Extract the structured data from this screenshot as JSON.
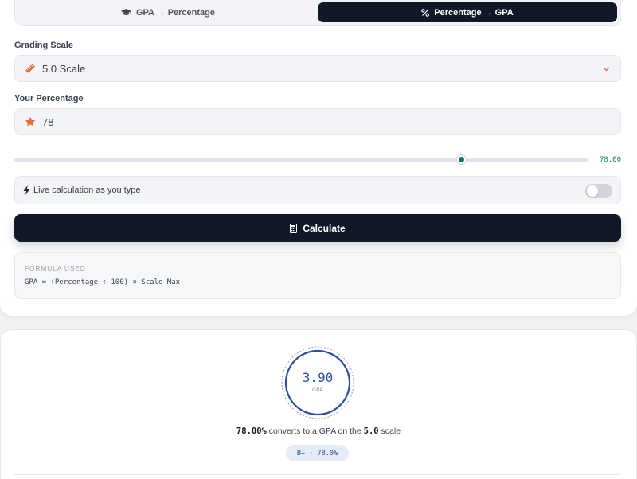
{
  "tabs": [
    {
      "label": "GPA → Percentage",
      "icon": "graduation-cap-icon",
      "active": false
    },
    {
      "label": "Percentage → GPA",
      "icon": "percent-icon",
      "active": true
    }
  ],
  "grading_scale": {
    "label": "Grading Scale",
    "value": "5.0 Scale",
    "icon": "ruler-icon"
  },
  "percentage": {
    "label": "Your Percentage",
    "value": "78",
    "icon": "star-icon"
  },
  "slider": {
    "value": 78,
    "min": 0,
    "max": 100,
    "readout": "78.00"
  },
  "live": {
    "label": "Live calculation as you type",
    "enabled": false
  },
  "calculate": {
    "label": "Calculate"
  },
  "formula": {
    "title": "FORMULA USED",
    "expression": "GPA = (Percentage ÷ 100) × Scale Max"
  },
  "result": {
    "gpa": "3.90",
    "unit": "GPA",
    "percent_text": "78.00%",
    "summary_mid": " converts to a GPA on the ",
    "scale_text": "5.0",
    "summary_end": " scale",
    "badge": "B+ · 78.0%"
  },
  "colors": {
    "accent": "#0f766e",
    "dark": "#111827",
    "result_blue": "#2a4ea0",
    "icon_orange": "#e0703a"
  }
}
